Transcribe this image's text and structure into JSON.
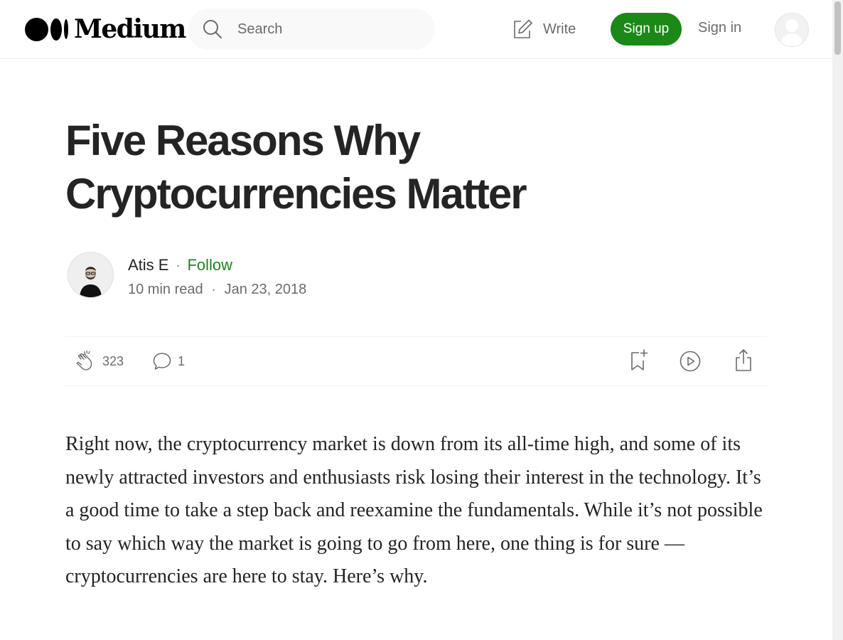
{
  "header": {
    "logo_text": "Medium",
    "search_placeholder": "Search",
    "write_label": "Write",
    "signup_label": "Sign up",
    "signin_label": "Sign in"
  },
  "article": {
    "title": "Five Reasons Why Cryptocurrencies Matter",
    "author": "Atis E",
    "separator": "·",
    "follow_label": "Follow",
    "read_time": "10 min read",
    "date": "Jan 23, 2018",
    "claps": "323",
    "responses": "1",
    "paragraph": "Right now, the cryptocurrency market is down from its all-time high, and some of its newly attracted investors and enthusiasts risk losing their interest in the technology. It’s a good time to take a step back and reexamine the fundamentals. While it’s not possible to say which way the market is going to go from here, one thing is for sure — cryptocurrencies are here to stay. Here’s why."
  },
  "icons": {
    "search": "search-icon",
    "write": "pencil-square-icon",
    "clap": "clap-icon",
    "comment": "speech-bubble-icon",
    "bookmark": "bookmark-add-icon",
    "listen": "play-circle-icon",
    "share": "share-icon"
  },
  "colors": {
    "accent_green": "#1a8917",
    "text_primary": "#242424",
    "text_secondary": "#6b6b6b"
  }
}
